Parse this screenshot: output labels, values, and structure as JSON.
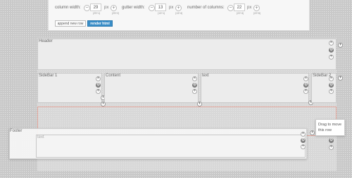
{
  "controls": {
    "column_width": {
      "label": "column width:",
      "value": "29",
      "unit": "px",
      "minus": "−",
      "plus": "+",
      "sub_left": "(29+1)",
      "sub_right": "(29+2)"
    },
    "gutter_width": {
      "label": "gutter width:",
      "value": "13",
      "unit": "px",
      "minus": "−",
      "plus": "+",
      "sub_left": "(13+1)",
      "sub_right": "(13+4)"
    },
    "num_columns": {
      "label": "number of columns:",
      "value": "22",
      "unit": "px",
      "minus": "−",
      "plus": "+",
      "sub_left": "(22+4)",
      "sub_right": "(22+6)"
    }
  },
  "buttons": {
    "append": "append new row",
    "render": "render html"
  },
  "blocks": {
    "header": "Header",
    "sidebar1": "SideBar 1",
    "content": "Content",
    "text": "text",
    "sidebar2": "SideBar 2",
    "footer": "Footer",
    "footer_inner": "text"
  },
  "icons": {
    "close": "×",
    "settings": "⚙",
    "add": "+",
    "resize": "›"
  },
  "tooltip": "Drag to move this row"
}
